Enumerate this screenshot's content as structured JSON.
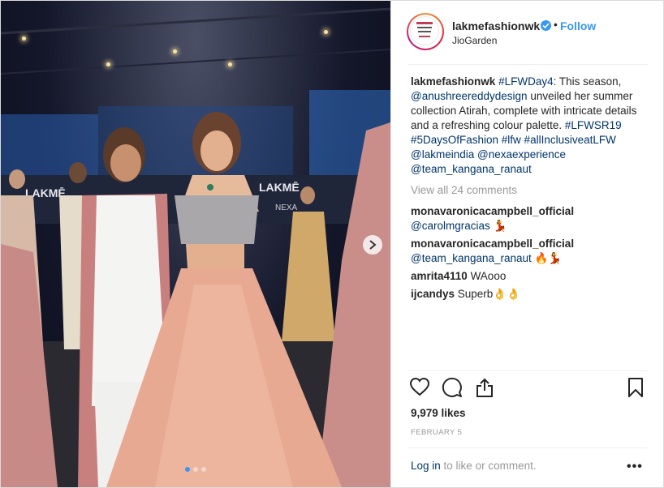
{
  "header": {
    "username": "lakmefashionwk",
    "separator": "•",
    "follow_label": "Follow",
    "location": "JioGarden"
  },
  "caption": {
    "username": "lakmefashionwk",
    "hashtag_day": "#LFWDay4",
    "text1": ": This season, ",
    "mention_designer": "@anushreereddydesign",
    "text2": " unveiled her summer collection Atirah, complete with intricate details and a refreshing colour palette. ",
    "hashtags": "#LFWSR19 #5DaysOfFashion #lfw #allInclusiveatLFW",
    "mentions": "@lakmeindia @nexaexperience @team_kangana_ranaut"
  },
  "view_all_comments": "View all 24 comments",
  "comments": [
    {
      "username": "monavaronicacampbell_official",
      "mention": "@carolmgracias",
      "text": " 💃"
    },
    {
      "username": "monavaronicacampbell_official",
      "mention": "@team_kangana_ranaut",
      "text": " 🔥💃"
    },
    {
      "username": "amrita4110",
      "mention": "",
      "text": " WAooo"
    },
    {
      "username": "ijcandys",
      "mention": "",
      "text": " Superb👌👌"
    }
  ],
  "likes": "9,979 likes",
  "date": "FEBRUARY 5",
  "login": {
    "link": "Log in",
    "rest": " to like or comment."
  },
  "more_label": "•••",
  "icons": {
    "like": "heart-icon",
    "comment": "comment-icon",
    "share": "share-icon",
    "save": "bookmark-icon",
    "next": "chevron-right-icon",
    "verified": "verified-badge-icon"
  },
  "colors": {
    "accent": "#3897f0",
    "link": "#003569",
    "muted": "#999999"
  },
  "photo": {
    "backdrop_brand_left": "LAKMĒ",
    "backdrop_brand_right": "LAKMĒ",
    "backdrop_sub": "NEXA"
  }
}
